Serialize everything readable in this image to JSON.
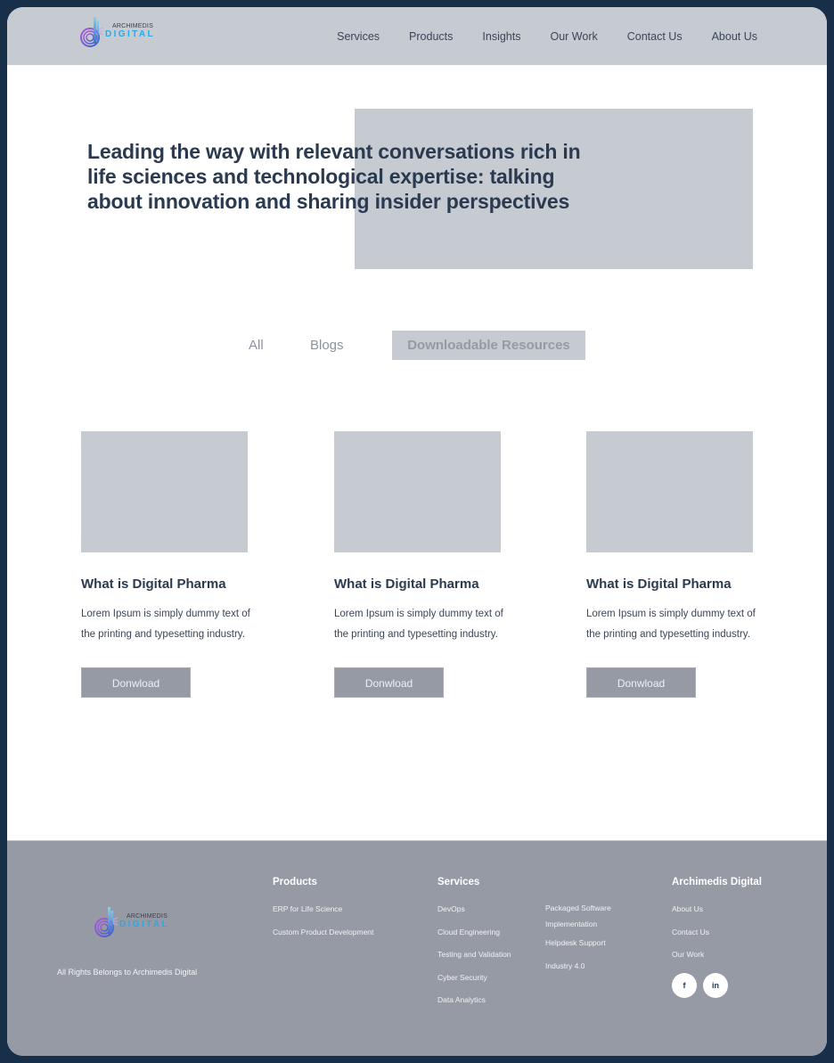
{
  "header": {
    "logo": {
      "top": "ARCHIMEDIS",
      "bottom": "DIGITAL",
      "icon": "archimedis-logo-icon"
    },
    "nav": [
      {
        "label": "Services"
      },
      {
        "label": "Products"
      },
      {
        "label": "Insights"
      },
      {
        "label": "Our Work"
      },
      {
        "label": "Contact Us"
      },
      {
        "label": "About Us"
      }
    ]
  },
  "hero": {
    "title": "Leading the way with relevant conversations rich in life sciences and technological expertise: talking about innovation and sharing insider perspectives"
  },
  "tabs": [
    {
      "label": "All",
      "active": false
    },
    {
      "label": "Blogs",
      "active": false
    },
    {
      "label": "Downloadable Resources",
      "active": true
    }
  ],
  "cards": [
    {
      "title": "What is Digital Pharma",
      "description": "Lorem Ipsum is simply dummy text of the printing and typesetting industry.",
      "button": "Donwload"
    },
    {
      "title": "What is Digital Pharma",
      "description": "Lorem Ipsum is simply dummy text of the printing and typesetting industry.",
      "button": "Donwload"
    },
    {
      "title": "What is Digital Pharma",
      "description": "Lorem Ipsum is simply dummy text of the printing and typesetting industry.",
      "button": "Donwload"
    }
  ],
  "footer": {
    "logo": {
      "top": "ARCHIMEDIS",
      "bottom": "DIGITAL"
    },
    "copyright": "All Rights Belongs to Archimedis Digital",
    "products": {
      "title": "Products",
      "links": [
        "ERP for Life Science",
        "Custom Product Development"
      ]
    },
    "services": {
      "title": "Services",
      "links": [
        "DevOps",
        "Cloud Engineering",
        "Testing and Validation",
        "Cyber Security",
        "Data Analytics"
      ],
      "links2": [
        "Packaged Software Implementation",
        "Helpdesk Support",
        "Industry 4.0"
      ]
    },
    "company": {
      "title": "Archimedis Digital",
      "links": [
        "About Us",
        "Contact Us",
        "Our Work"
      ]
    },
    "socials": [
      {
        "label": "f",
        "icon": "facebook-icon"
      },
      {
        "label": "in",
        "icon": "linkedin-icon"
      }
    ]
  },
  "colors": {
    "frame": "#172f48",
    "header_bg": "#c6cbd2",
    "placeholder": "#c6cbd2",
    "footer_bg": "#959aa5",
    "heading": "#2a3a50",
    "button_bg": "#959aa5"
  }
}
